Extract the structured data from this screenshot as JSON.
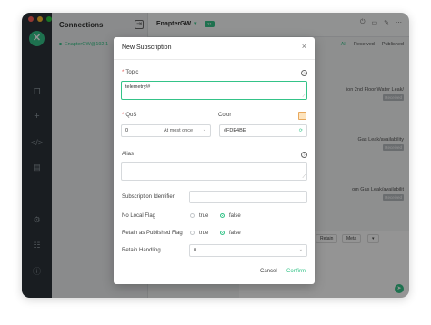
{
  "window": {
    "traffic_lights": [
      "#fe5f57",
      "#febc2e",
      "#28c840"
    ],
    "accent": "#34c388"
  },
  "rail": {
    "logo_icon": "close-x-icon",
    "icons": [
      "copy-icon",
      "plus-icon",
      "code-icon",
      "log-icon",
      "settings-icon",
      "sliders-icon",
      "info-icon"
    ]
  },
  "connections": {
    "title": "Connections",
    "items": [
      {
        "label": "EnapterGW@192.1"
      }
    ]
  },
  "main": {
    "title": "EnapterGW",
    "badge": "21",
    "filters": [
      "All",
      "Received",
      "Published"
    ],
    "messages": [
      {
        "text": "ion 2nd Floor Water Leak/",
        "tag": "Received"
      },
      {
        "text": "Gas Leak/availability",
        "tag": "Received"
      },
      {
        "text": "om Gas Leak/availabilit",
        "tag": "Received"
      }
    ],
    "bottom": {
      "retain": "Retain",
      "meta": "Meta"
    }
  },
  "dialog": {
    "title": "New Subscription",
    "topic": {
      "label": "Topic",
      "value": "telemetry/#"
    },
    "qos": {
      "label": "QoS",
      "value": "0",
      "text": "At most once"
    },
    "color": {
      "label": "Color",
      "value": "#FDE4BE",
      "swatch": "#fde4be"
    },
    "alias": {
      "label": "Alias",
      "value": ""
    },
    "subscription_identifier": {
      "label": "Subscription Identifier",
      "value": ""
    },
    "no_local_flag": {
      "label": "No Local Flag",
      "true_label": "true",
      "false_label": "false",
      "selected": "false"
    },
    "retain_as_published": {
      "label": "Retain as Published Flag",
      "true_label": "true",
      "false_label": "false",
      "selected": "false"
    },
    "retain_handling": {
      "label": "Retain Handling",
      "value": "0"
    },
    "buttons": {
      "cancel": "Cancel",
      "confirm": "Confirm"
    }
  }
}
